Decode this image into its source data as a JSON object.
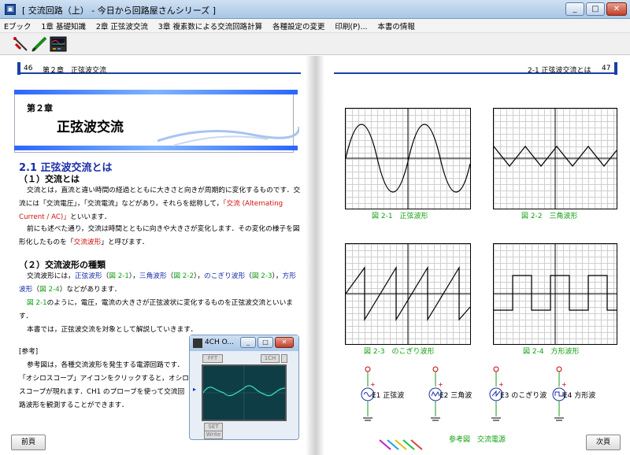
{
  "window": {
    "title": "[ 交流回路（上） - 今日から回路屋さんシリーズ ]",
    "btn_min": "_",
    "btn_max": "□",
    "btn_close": "✕"
  },
  "menu": [
    "Eブック",
    "1章 基礎知識",
    "2章 正弦波交流",
    "3章 複素数による交流回路計算",
    "各種設定の変更",
    "印刷(P)...",
    "本書の情報"
  ],
  "toolbar_icons": [
    "probe-icon",
    "pen-icon",
    "oscilloscope-icon"
  ],
  "left": {
    "page_no": "46",
    "header": "第２章　正弦波交流",
    "chapter_sub": "第２章",
    "chapter_title": "正弦波交流",
    "sec21": "2.1 正弦波交流とは",
    "h1": "（１）交流とは",
    "p1a": "交流とは，直流と違い時間の経過とともに大きさと向きが周期的に変化するものです．交流には「交流電圧」，「交流電流」などがあり，それらを総称して，",
    "p1_red": "「交流 (Alternating Current / AC)」",
    "p1b": "といいます．",
    "p2a": "前にも述べた通り，交流は時間とともに向きや大きさが変化します．その変化の様子を図形化したものを「",
    "p2_red": "交流波形",
    "p2b": "」と呼びます．",
    "h2": "（２）交流波形の種類",
    "p3_intro": "交流波形には，",
    "p3_t1": "正弦波形",
    "p3_f1": "図 2-1",
    "p3_t2": "三角波形",
    "p3_f2": "図 2-2",
    "p3_t3": "のこぎり波形",
    "p3_f3": "図 2-3",
    "p3_t4": "方形波形",
    "p3_f4": "図 2-4",
    "p3_end": "などがあります．",
    "p4_fig": "図 2-1",
    "p4": "のように，電圧，電流の大きさが正弦波状に変化するものを正弦波交流といいます．",
    "p5": "本書では，正弦波交流を対象として解説していきます．",
    "ref_h": "[参考]",
    "ref": "参考図は，各種交流波形を発生する電源回路です．「オシロスコープ」アイコンをクリックすると，オシロスコープが現れます．CH1 のプローブを使って交流回路波形を観測することができます．",
    "prev": "前頁"
  },
  "right": {
    "header": "2-1 正弦波交流とは",
    "page_no": "47",
    "fig1": "図 2-1　正弦波形",
    "fig2": "図 2-2　三角波形",
    "fig3": "図 2-3　のこぎり波形",
    "fig4": "図 2-4　方形波形",
    "e1": "E1 正弦波",
    "e2": "E2 三角波",
    "e3": "E3 のこぎり波",
    "e4": "E4 方形波",
    "ref_fig": "参考図　交流電源",
    "next": "次頁"
  },
  "osc": {
    "title": "4CH O...",
    "fft": "FFT",
    "ch": "1CH",
    "set": "SET",
    "write": "Write"
  }
}
